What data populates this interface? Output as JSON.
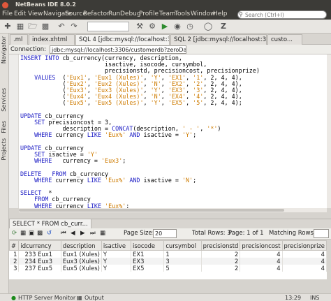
{
  "window": {
    "title": "NetBeans IDE 8.0.2"
  },
  "menu": [
    "File",
    "Edit",
    "View",
    "Navigate",
    "Source",
    "Refactor",
    "Run",
    "Debug",
    "Profile",
    "Team",
    "Tools",
    "Window",
    "Help"
  ],
  "search": {
    "placeholder": "Search (Ctrl+I)"
  },
  "side_tabs": [
    "Navigator",
    "Services",
    "Files",
    "Projects"
  ],
  "editor_tabs": [
    ".ml",
    "index.xhtml",
    "SQL 4 [jdbc:mysql://localhost:33...",
    "SQL 2 [jdbc:mysql://localhost:33...",
    "custo..."
  ],
  "connection": {
    "label": "Connection:",
    "value": "jdbc:mysql://localhost:3306/customerdb?zeroDateTi..."
  },
  "results": {
    "tab": "SELECT * FROM cb_curr...",
    "page_size_label": "Page Size:",
    "page_size": "20",
    "total_rows_label": "Total Rows: 3",
    "page_label": "Page: 1 of 1",
    "matching_rows_label": "Matching Rows:",
    "columns": [
      "#",
      "idcurrency",
      "currency",
      "description",
      "isactive",
      "isocode",
      "cursymbol",
      "precisionstd",
      "precisioncost",
      "precisionprize"
    ],
    "rows": [
      [
        "1",
        "233",
        "Eux1",
        "Eux1 (Xules)",
        "Y",
        "EX1",
        "1",
        "2",
        "4",
        "4"
      ],
      [
        "2",
        "234",
        "Eux3",
        "Eux3 (Xules)",
        "Y",
        "EX3",
        "3",
        "2",
        "4",
        "4"
      ],
      [
        "3",
        "237",
        "Eux5",
        "Eux5 (Xules)",
        "Y",
        "EX5",
        "5",
        "2",
        "4",
        "4"
      ]
    ]
  },
  "status": {
    "output_tab": "Output",
    "http_monitor": "HTTP Server Monitor",
    "position": "13:29",
    "mode": "INS"
  }
}
